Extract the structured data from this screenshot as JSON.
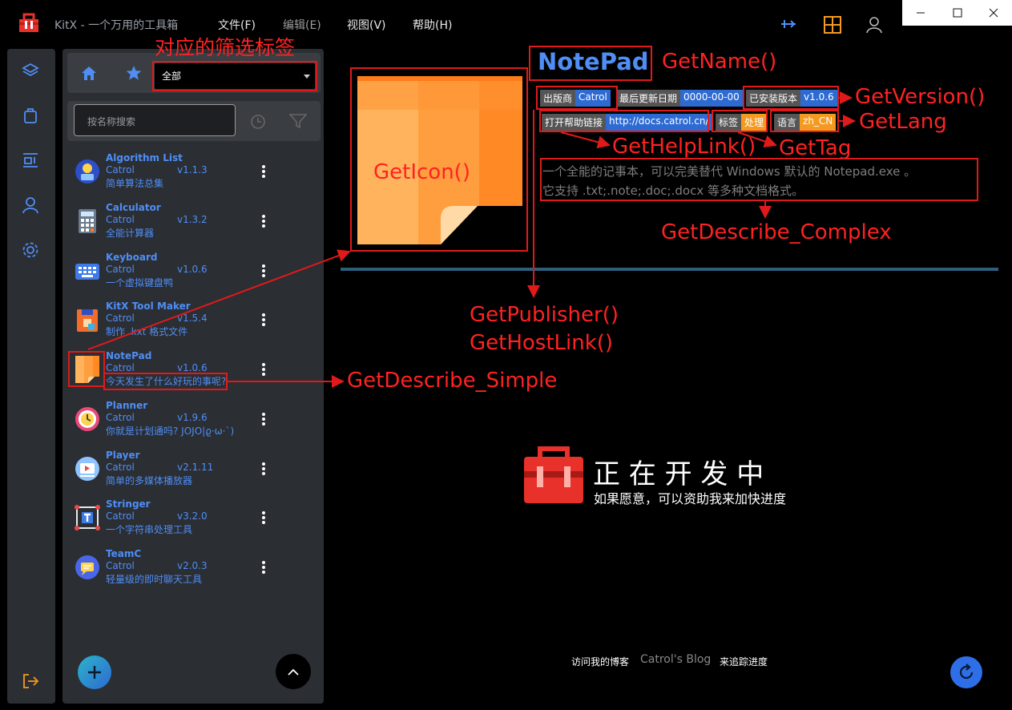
{
  "window": {
    "title": "KitX - 一个万用的工具箱",
    "menus": [
      "文件(F)",
      "编辑(E)",
      "视图(V)",
      "帮助(H)"
    ]
  },
  "filter": {
    "selected": "全部",
    "annotation": "对应的筛选标签"
  },
  "search": {
    "placeholder": "按名称搜索"
  },
  "plugins": [
    {
      "name": "Algorithm List",
      "publisher": "Catrol",
      "version": "v1.1.3",
      "desc": "简单算法总集"
    },
    {
      "name": "Calculator",
      "publisher": "Catrol",
      "version": "v1.3.2",
      "desc": "全能计算器"
    },
    {
      "name": "Keyboard",
      "publisher": "Catrol",
      "version": "v1.0.6",
      "desc": "一个虚拟键盘鸭"
    },
    {
      "name": "KitX Tool Maker",
      "publisher": "Catrol",
      "version": "v1.5.4",
      "desc": "制作 .kxt 格式文件"
    },
    {
      "name": "NotePad",
      "publisher": "Catrol",
      "version": "v1.0.6",
      "desc": "今天发生了什么好玩的事呢?"
    },
    {
      "name": "Planner",
      "publisher": "Catrol",
      "version": "v1.9.6",
      "desc": "你就是计划通吗?  JOJO|ϱ·ω·`)"
    },
    {
      "name": "Player",
      "publisher": "Catrol",
      "version": "v2.1.11",
      "desc": "简单的多媒体播放器"
    },
    {
      "name": "Stringer",
      "publisher": "Catrol",
      "version": "v3.2.0",
      "desc": "一个字符串处理工具"
    },
    {
      "name": "TeamC",
      "publisher": "Catrol",
      "version": "v2.0.3",
      "desc": "轻量级的即时聊天工具"
    }
  ],
  "detail": {
    "name": "NotePad",
    "tags": {
      "publisher_label": "出版商",
      "publisher": "Catrol",
      "updated_label": "最后更新日期",
      "updated": "0000-00-00",
      "installed_label": "已安装版本",
      "installed": "v1.0.6",
      "help_label": "打开帮助链接",
      "help": "http://docs.catrol.cn/",
      "tag_label": "标签",
      "tag": "处理",
      "lang_label": "语言",
      "lang": "zh_CN"
    },
    "desc_line1": "一个全能的记事本，可以完美替代 Windows 默认的 Notepad.exe 。",
    "desc_line2": "它支持 .txt;.note;.doc;.docx 等多种文档格式。"
  },
  "annotations": {
    "get_name": "GetName()",
    "get_version": "GetVersion()",
    "get_lang": "GetLang",
    "get_help_link": "GetHelpLink()",
    "get_tag": "GetTag",
    "get_icon": "GetIcon()",
    "get_describe_complex": "GetDescribe_Complex",
    "get_publisher": "GetPublisher()",
    "get_host_link": "GetHostLink()",
    "get_describe_simple": "GetDescribe_Simple"
  },
  "dev": {
    "title": "正 在 开 发 中",
    "subtitle": "如果愿意，可以资助我来加快进度"
  },
  "footer": {
    "blog_prefix": "访问我的博客",
    "blog": "Catrol's Blog",
    "blog_suffix": "来追踪进度"
  },
  "colors": {
    "accent": "#4f8ef5",
    "annotation": "#ff2222",
    "panel": "#2b2e33"
  }
}
